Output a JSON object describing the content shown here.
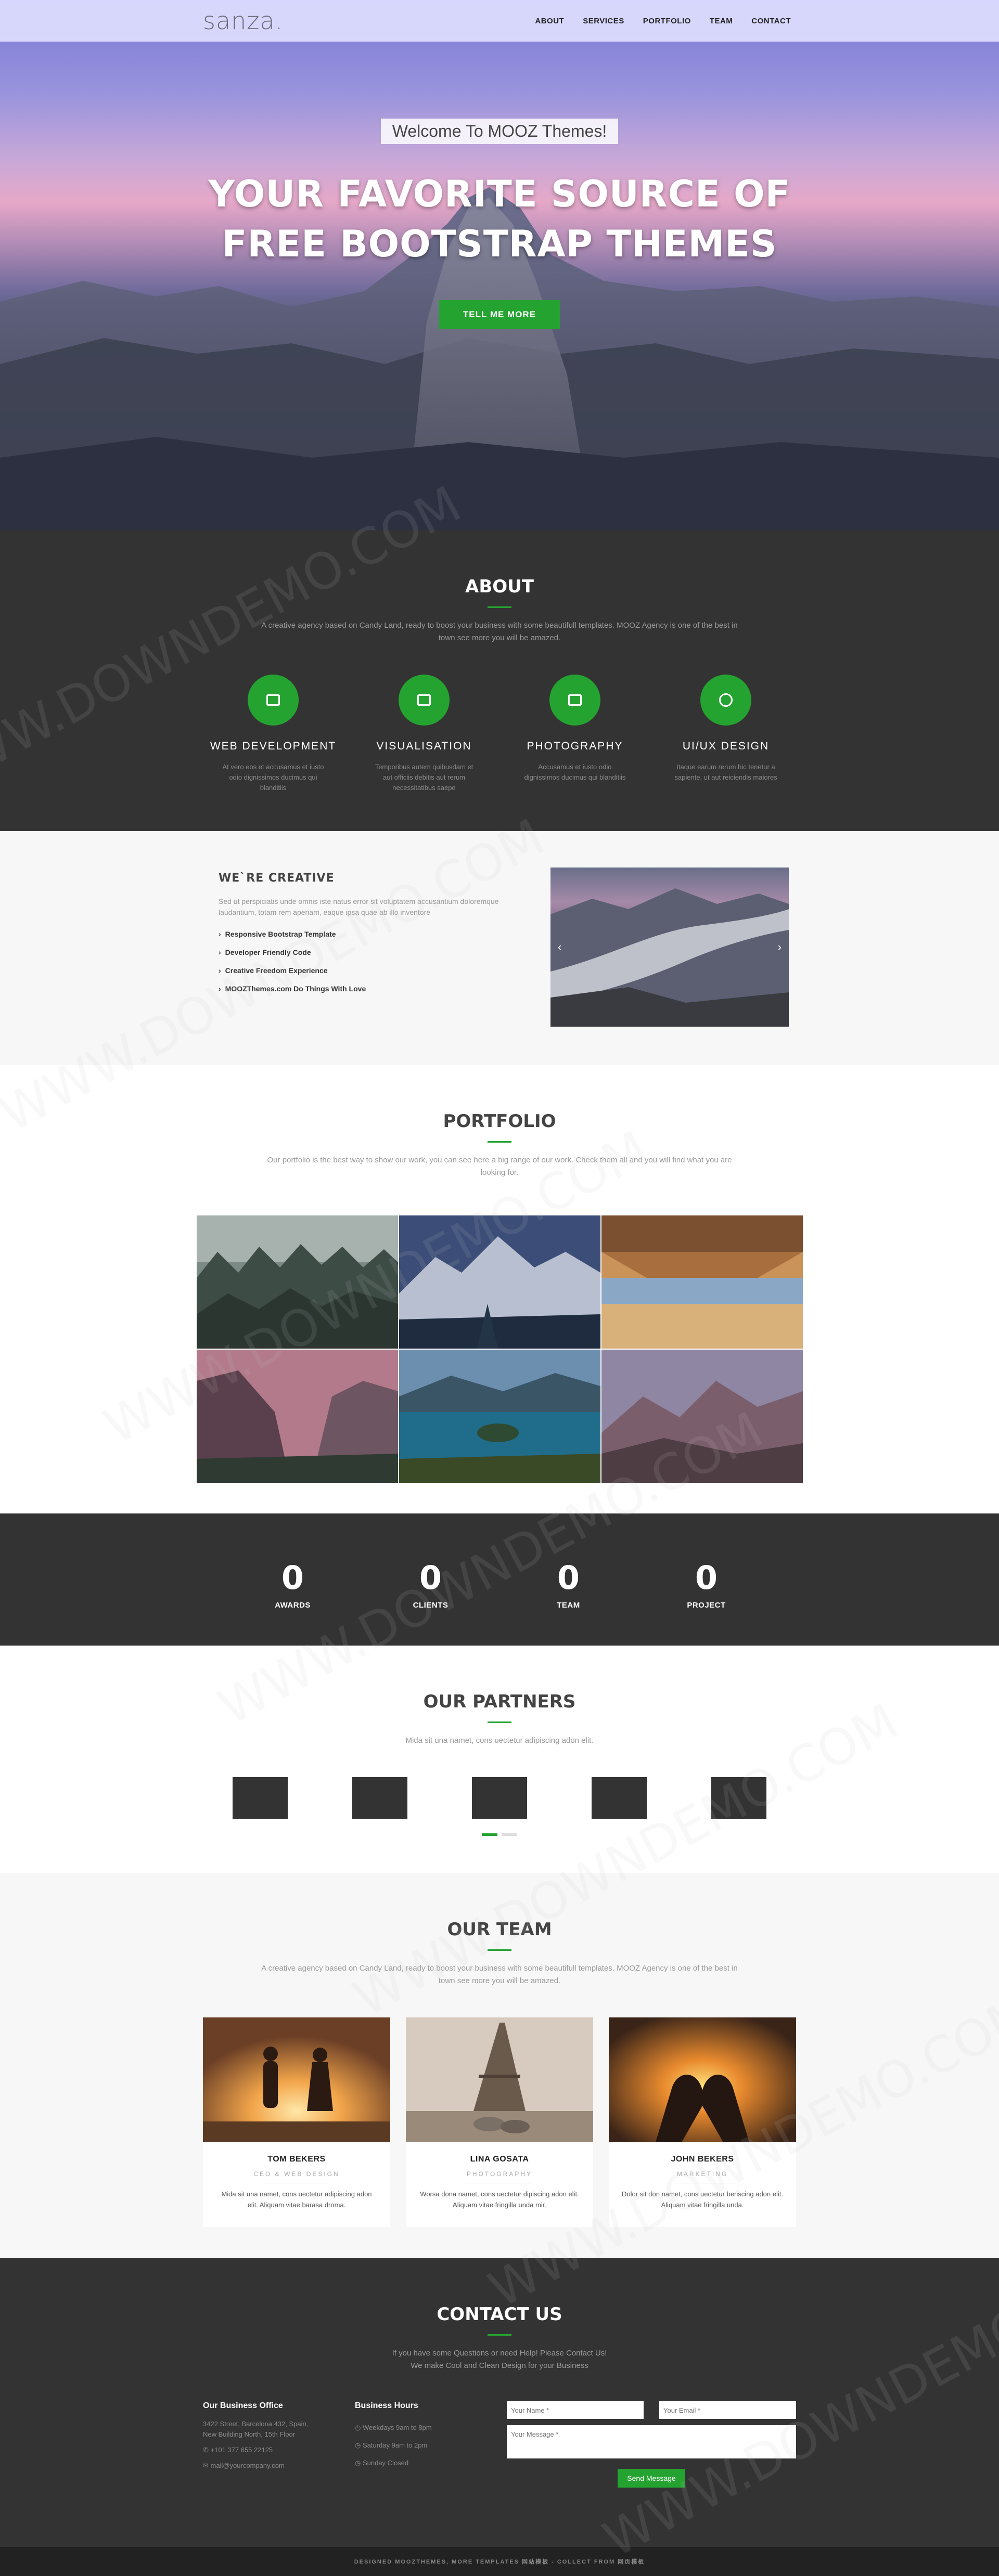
{
  "nav": {
    "brand": "sanza.",
    "menu": [
      "ABOUT",
      "SERVICES",
      "PORTFOLIO",
      "TEAM",
      "CONTACT"
    ]
  },
  "hero": {
    "welcome": "Welcome To MOOZ Themes!",
    "title_line1": "YOUR FAVORITE SOURCE OF",
    "title_line2": "FREE BOOTSTRAP THEMES",
    "button": "TELL ME MORE"
  },
  "about": {
    "title": "ABOUT",
    "desc": "A creative agency based on Candy Land, ready to boost your business with some beautifull templates. MOOZ Agency is one of the best in town see more you will be amazed.",
    "features": [
      {
        "icon": "briefcase-icon",
        "title": "WEB DEVELOPMENT",
        "desc": "At vero eos et accusamus et iusto odio dignissimos ducimus qui blanditiis"
      },
      {
        "icon": "image-icon",
        "title": "VISUALISATION",
        "desc": "Temporibus autem quibusdam et aut officiis debitis aut rerum necessitatibus saepe"
      },
      {
        "icon": "photo-icon",
        "title": "PHOTOGRAPHY",
        "desc": "Accusamus et iusto odio dignissimos ducimus qui blanditiis"
      },
      {
        "icon": "globe-icon",
        "title": "UI/UX DESIGN",
        "desc": "Itaque earum rerum hic tenetur a sapiente, ut aut reiciendis maiores"
      }
    ]
  },
  "creative": {
    "title": "WE`RE CREATIVE",
    "desc": "Sed ut perspiciatis unde omnis iste natus error sit voluptatem accusantium doloremque laudantium, totam rem aperiam, eaque ipsa quae ab illo inventore",
    "list": [
      "Responsive Bootstrap Template",
      "Developer Friendly Code",
      "Creative Freedom Experience",
      "MOOZThemes.com Do Things With Love"
    ],
    "prev": "‹",
    "next": "›"
  },
  "portfolio": {
    "title": "PORTFOLIO",
    "desc": "Our portfolio is the best way to show our work, you can see here a big range of our work. Check them all and you will find what you are looking for."
  },
  "counters": [
    {
      "value": "0",
      "label": "AWARDS"
    },
    {
      "value": "0",
      "label": "CLIENTS"
    },
    {
      "value": "0",
      "label": "TEAM"
    },
    {
      "value": "0",
      "label": "PROJECT"
    }
  ],
  "partners": {
    "title": "OUR PARTNERS",
    "desc": "Mida sit una namet, cons uectetur adipiscing adon elit."
  },
  "team": {
    "title": "OUR TEAM",
    "desc": "A creative agency based on Candy Land, ready to boost your business with some beautifull templates. MOOZ Agency is one of the best in town see more you will be amazed.",
    "members": [
      {
        "name": "TOM BEKERS",
        "role": "CEO & WEB DESIGN",
        "desc": "Mida sit una namet, cons uectetur adipiscing adon elit. Aliquam vitae barasa droma."
      },
      {
        "name": "LINA GOSATA",
        "role": "PHOTOGRAPHY",
        "desc": "Worsa dona namet, cons uectetur dipiscing adon elit. Aliquam vitae fringilla unda mir."
      },
      {
        "name": "JOHN BEKERS",
        "role": "MARKETING",
        "desc": "Dolor sit don namet, cons uectetur beriscing adon elit. Aliquam vitae fringilla unda."
      }
    ]
  },
  "contact": {
    "title": "CONTACT US",
    "desc_line1": "If you have some Questions or need Help! Please Contact Us!",
    "desc_line2": "We make Cool and Clean Design for your Business",
    "office_title": "Our Business Office",
    "address_line1": "3422 Street, Barcelona 432, Spain,",
    "address_line2": "New Building North, 15th Floor",
    "phone": "+101 377 655 22125",
    "email": "mail@yourcompany.com",
    "hours_title": "Business Hours",
    "hours": [
      "Weekdays 9am to 8pm",
      "Saturday 9am to 2pm",
      "Sunday Closed"
    ],
    "name_placeholder": "Your Name *",
    "email_placeholder": "Your Email *",
    "message_placeholder": "Your Message *",
    "submit": "Send Message"
  },
  "footer": {
    "text": "DESIGNED MOOZTHEMES, MORE TEMPLATES 网站模板 - COLLECT FROM 网页模板"
  },
  "watermark": {
    "text": "WWW.DOWNDEMO.COM"
  },
  "colors": {
    "accent": "#25a331",
    "dark": "#333333"
  }
}
